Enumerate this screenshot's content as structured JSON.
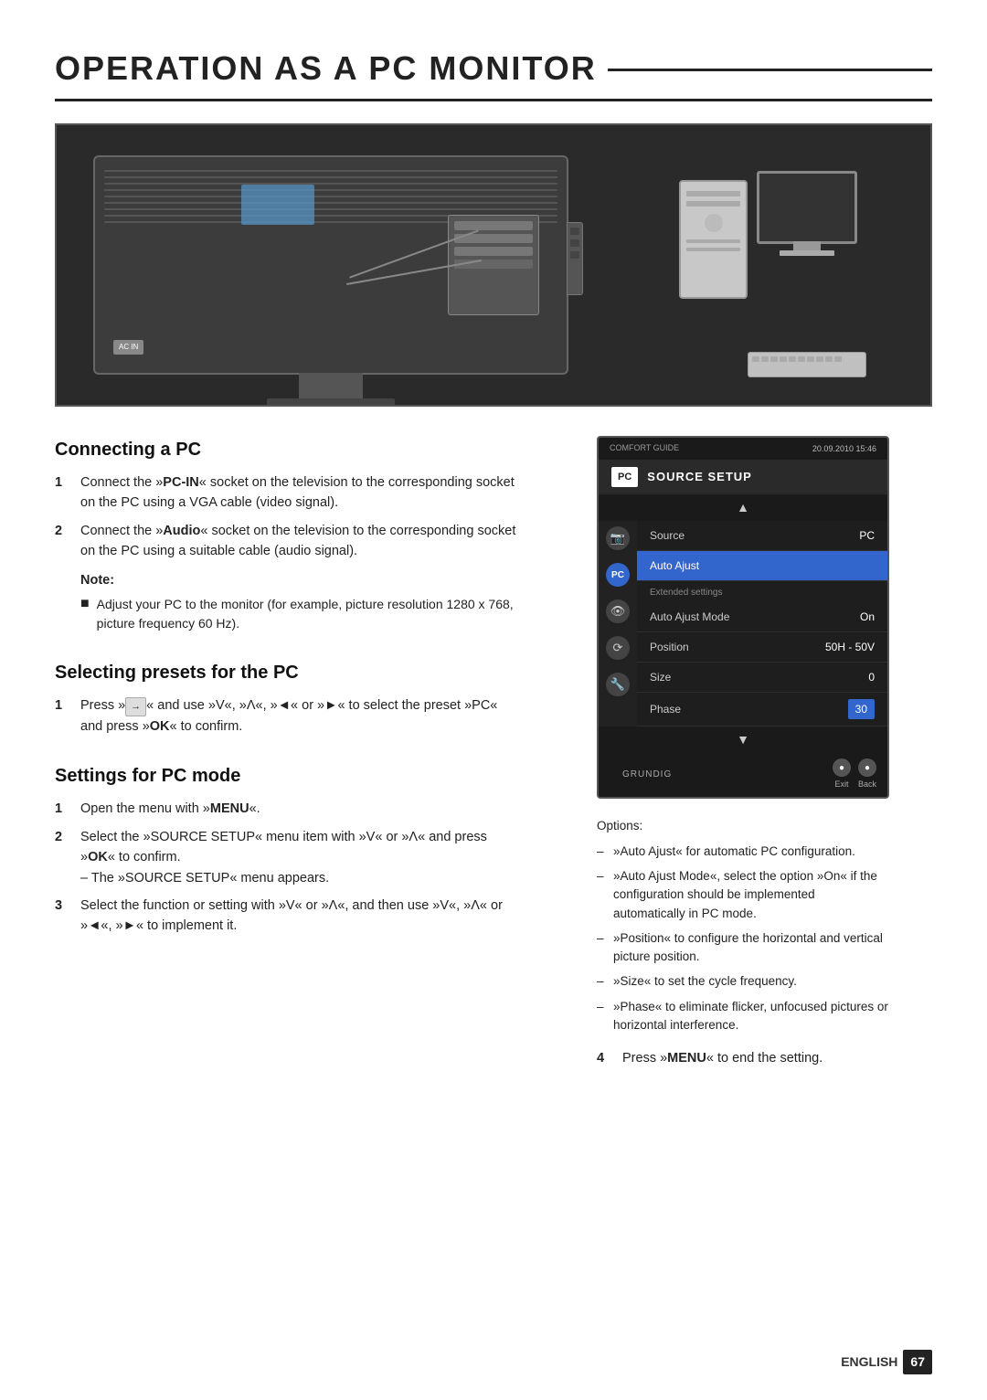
{
  "page": {
    "title": "OPERATION AS A PC MONITOR",
    "footer": {
      "lang": "ENGLISH",
      "page_num": "67"
    }
  },
  "sections": {
    "connecting": {
      "title": "Connecting a PC",
      "steps": [
        {
          "num": "1",
          "text_before": "Connect the »",
          "bold": "PC-IN",
          "text_after": "« socket on the television to the corresponding socket on the PC using a VGA cable (video signal)."
        },
        {
          "num": "2",
          "text_before": "Connect the »",
          "bold": "Audio",
          "text_after": "« socket on the television to the corresponding socket on the PC using a suitable cable (audio signal)."
        }
      ],
      "note": {
        "label": "Note:",
        "item": "Adjust your PC to the monitor (for example, picture resolution 1280 x 768, picture frequency 60 Hz)."
      }
    },
    "selecting": {
      "title": "Selecting presets for the PC",
      "steps": [
        {
          "num": "1",
          "text": "Press »",
          "bold_mid": "→",
          "text2": "« and use »V«, »Λ«, »◄« or »►« to select the preset »PC« and press »",
          "bold2": "OK",
          "text3": "« to confirm."
        }
      ]
    },
    "settings": {
      "title": "Settings for PC mode",
      "steps": [
        {
          "num": "1",
          "text": "Open the menu with »",
          "bold": "MENU",
          "text2": "«."
        },
        {
          "num": "2",
          "text": "Select the »SOURCE SETUP« menu item with »V« or »Λ« and press »",
          "bold": "OK",
          "text2": "« to confirm.",
          "sub": "– The »SOURCE SETUP« menu appears."
        },
        {
          "num": "3",
          "text": "Select the function or setting with »V« or »Λ«, and then use »V«, »Λ« or »◄«, »►« to implement it."
        }
      ]
    },
    "step4": {
      "num": "4",
      "text": "Press »",
      "bold": "MENU",
      "text2": "« to end the setting."
    }
  },
  "menu": {
    "comfort_guide": "COMFORT\nGUIDE",
    "datetime": "20.09.2010\n15:46",
    "header_badge": "PC",
    "header_title": "SOURCE SETUP",
    "rows": [
      {
        "label": "Source",
        "value": "PC",
        "highlighted": false
      },
      {
        "label": "Auto Ajust",
        "value": "",
        "highlighted": true,
        "full": true
      },
      {
        "section_label": "Extended settings"
      },
      {
        "label": "Auto Ajust Mode",
        "value": "On",
        "highlighted": false
      },
      {
        "label": "Position",
        "value": "50H - 50V",
        "highlighted": false
      },
      {
        "label": "Size",
        "value": "0",
        "highlighted": false
      },
      {
        "label": "Phase",
        "value": "30",
        "highlighted": false,
        "value_highlighted": true
      }
    ],
    "bottom_buttons": [
      {
        "label": "Exit",
        "symbol": "●"
      },
      {
        "label": "Back",
        "symbol": "●"
      }
    ],
    "brand": "GRUNDIG"
  },
  "options": {
    "title": "Options:",
    "items": [
      "»Auto Ajust« for automatic PC configuration.",
      "»Auto Ajust Mode«, select the option »On« if the configuration should be implemented automatically in PC mode.",
      "»Position« to configure the horizontal and vertical picture position.",
      "»Size« to set the cycle frequency.",
      "»Phase« to eliminate flicker, unfocused pictures or horizontal interference."
    ]
  },
  "icons": {
    "camera": "📷",
    "pc": "💻",
    "eye": "👁",
    "tools": "🔧",
    "wrench": "🔨"
  }
}
